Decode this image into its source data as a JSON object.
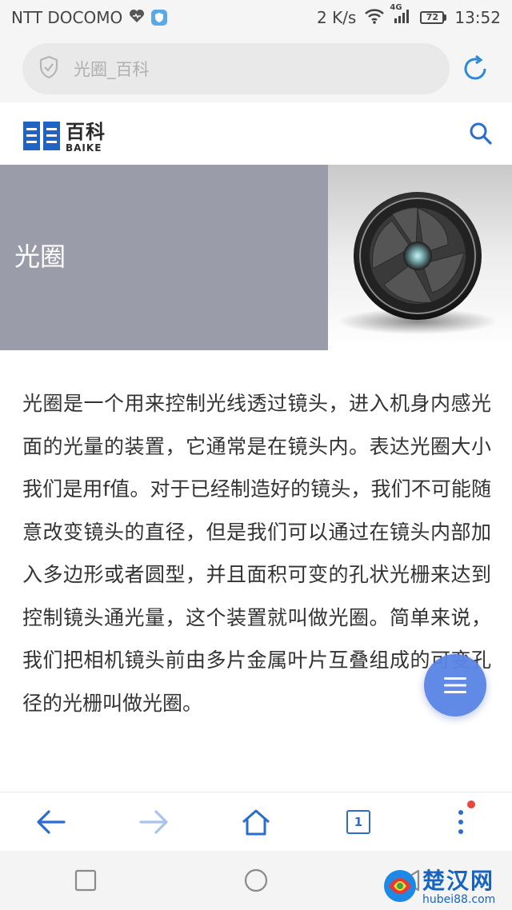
{
  "status_bar": {
    "carrier": "NTT DOCOMO",
    "speed": "2 K/s",
    "network": "4G",
    "battery": "72",
    "time": "13:52"
  },
  "address_bar": {
    "text": "光圈_百科"
  },
  "site": {
    "logo_cn": "百科",
    "logo_en": "BAIKE"
  },
  "banner": {
    "title": "光圈"
  },
  "article": {
    "body": "光圈是一个用来控制光线透过镜头，进入机身内感光面的光量的装置，它通常是在镜头内。表达光圈大小我们是用f值。对于已经制造好的镜头，我们不可能随意改变镜头的直径，但是我们可以通过在镜头内部加入多边形或者圆型，并且面积可变的孔状光栅来达到控制镜头通光量，这个装置就叫做光圈。简单来说，我们把相机镜头前由多片金属叶片互叠组成的可变孔径的光栅叫做光圈。"
  },
  "bottom_nav": {
    "tab_count": "1"
  },
  "watermark": {
    "name": "楚汉网",
    "url": "hubei88.com"
  },
  "colors": {
    "accent": "#2a6ccf",
    "banner_bg": "#9a9caa",
    "fab": "#5b86e5"
  },
  "icons": [
    "heart-icon",
    "shield-icon",
    "wifi-icon",
    "signal-icon",
    "battery-icon",
    "refresh-icon",
    "search-icon",
    "camera-lens-image",
    "menu-icon",
    "back-arrow-icon",
    "forward-arrow-icon",
    "home-icon",
    "tabs-icon",
    "more-icon",
    "square-icon",
    "circle-icon",
    "triangle-back-icon"
  ]
}
